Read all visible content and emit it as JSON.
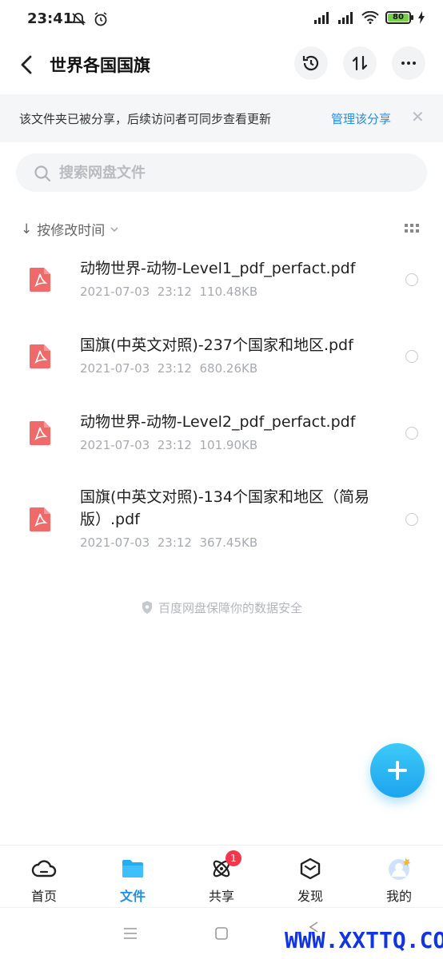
{
  "status_bar": {
    "time": "23:41",
    "battery": "80"
  },
  "header": {
    "title": "世界各国国旗"
  },
  "notice": {
    "text": "该文件夹已被分享，后续访问者可同步查看更新",
    "link": "管理该分享"
  },
  "search": {
    "placeholder": "搜索网盘文件"
  },
  "sort": {
    "label": "按修改时间"
  },
  "files": [
    {
      "name": "动物世界-动物-Level1_pdf_perfact.pdf",
      "date": "2021-07-03",
      "time": "23:12",
      "size": "110.48KB"
    },
    {
      "name": "国旗(中英文对照)-237个国家和地区.pdf",
      "date": "2021-07-03",
      "time": "23:12",
      "size": "680.26KB"
    },
    {
      "name": "动物世界-动物-Level2_pdf_perfact.pdf",
      "date": "2021-07-03",
      "time": "23:12",
      "size": "101.90KB"
    },
    {
      "name": "国旗(中英文对照)-134个国家和地区（简易版）.pdf",
      "date": "2021-07-03",
      "time": "23:12",
      "size": "367.45KB"
    }
  ],
  "footer_note": "百度网盘保障你的数据安全",
  "nav": [
    {
      "label": "首页",
      "icon": "cloud-icon"
    },
    {
      "label": "文件",
      "icon": "folder-icon"
    },
    {
      "label": "共享",
      "icon": "atom-icon",
      "badge": "1"
    },
    {
      "label": "发现",
      "icon": "cube-icon"
    },
    {
      "label": "我的",
      "icon": "avatar-icon"
    }
  ],
  "watermark": "WWW.XXTTQ.COM",
  "colors": {
    "accent": "#1f8fe6",
    "pdf": "#f06a6a",
    "badge": "#f2364b"
  }
}
